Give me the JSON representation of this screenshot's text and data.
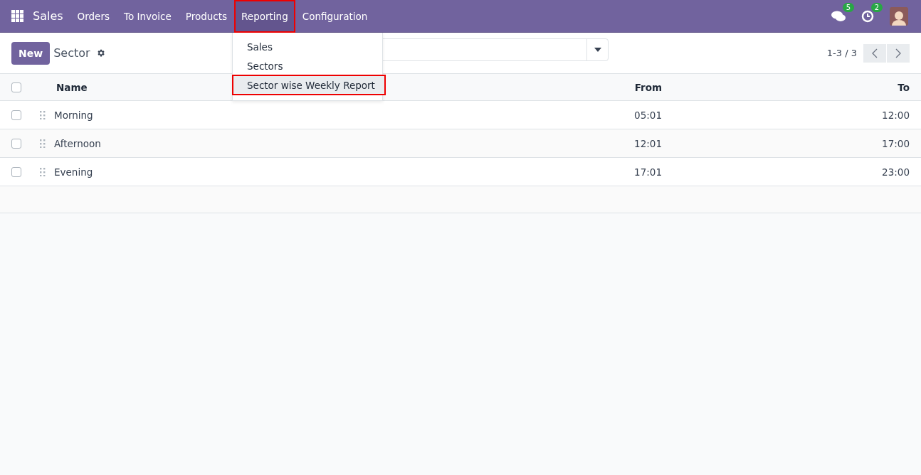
{
  "navbar": {
    "app": "Sales",
    "menu": [
      {
        "label": "Orders",
        "open": false
      },
      {
        "label": "To Invoice",
        "open": false
      },
      {
        "label": "Products",
        "open": false
      },
      {
        "label": "Reporting",
        "open": true
      },
      {
        "label": "Configuration",
        "open": false
      }
    ],
    "messages_count": "5",
    "activities_count": "2"
  },
  "dropdown": {
    "items": [
      {
        "label": "Sales",
        "highlighted": false
      },
      {
        "label": "Sectors",
        "highlighted": false
      },
      {
        "label": "Sector wise Weekly Report",
        "highlighted": true
      }
    ]
  },
  "control_panel": {
    "new_button": "New",
    "title": "Sector",
    "pager": "1-3 / 3"
  },
  "table": {
    "select_all_checked": false,
    "columns": [
      "Name",
      "From",
      "To"
    ],
    "rows": [
      {
        "name": "Morning",
        "from": "05:01",
        "to": "12:00",
        "checked": false
      },
      {
        "name": "Afternoon",
        "from": "12:01",
        "to": "17:00",
        "checked": false
      },
      {
        "name": "Evening",
        "from": "17:01",
        "to": "23:00",
        "checked": false
      }
    ]
  }
}
